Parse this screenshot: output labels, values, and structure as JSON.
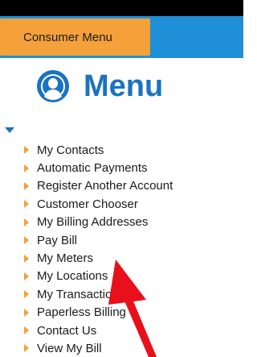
{
  "header": {
    "consumer_menu_label": "Consumer Menu"
  },
  "menu": {
    "title": "Menu",
    "items": [
      {
        "label": "My Contacts"
      },
      {
        "label": "Automatic Payments"
      },
      {
        "label": "Register Another Account"
      },
      {
        "label": "Customer Chooser"
      },
      {
        "label": "My Billing Addresses"
      },
      {
        "label": "Pay Bill"
      },
      {
        "label": "My Meters"
      },
      {
        "label": "My Locations"
      },
      {
        "label": "My Transactions"
      },
      {
        "label": "Paperless Billing"
      },
      {
        "label": "Contact Us"
      },
      {
        "label": "View My Bill"
      }
    ]
  },
  "icons": {
    "menu_icon": "user-circle-icon",
    "bullet_icon": "caret-right-icon",
    "collapse_icon": "caret-down-icon",
    "annotation": "red-arrow-icon"
  },
  "colors": {
    "top_bar": "#000000",
    "header_blue": "#1f8fd8",
    "tab_orange": "#f4a13a",
    "title_blue": "#1a73c0",
    "bullet_orange": "#f4a13a",
    "annotation_red": "#e8101a"
  }
}
